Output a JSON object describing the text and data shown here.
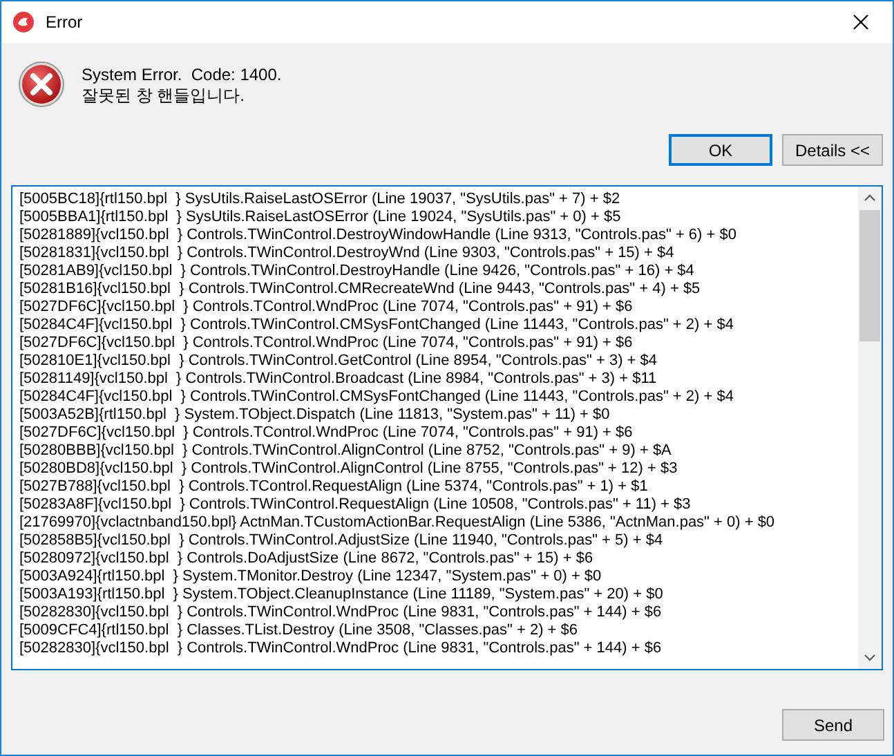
{
  "window": {
    "title": "Error"
  },
  "message": {
    "line_1": "System Error.  Code: 1400.",
    "line_2": "잘못된 창 핸들입니다."
  },
  "buttons": [
    {
      "label": "OK",
      "selected": true
    },
    {
      "label": "Details <<",
      "selected": false
    }
  ],
  "details": {
    "lines": [
      "[5005BC18]{rtl150.bpl  } SysUtils.RaiseLastOSError (Line 19037, \"SysUtils.pas\" + 7) + $2",
      "[5005BBA1]{rtl150.bpl  } SysUtils.RaiseLastOSError (Line 19024, \"SysUtils.pas\" + 0) + $5",
      "[50281889]{vcl150.bpl  } Controls.TWinControl.DestroyWindowHandle (Line 9313, \"Controls.pas\" + 6) + $0",
      "[50281831]{vcl150.bpl  } Controls.TWinControl.DestroyWnd (Line 9303, \"Controls.pas\" + 15) + $4",
      "[50281AB9]{vcl150.bpl  } Controls.TWinControl.DestroyHandle (Line 9426, \"Controls.pas\" + 16) + $4",
      "[50281B16]{vcl150.bpl  } Controls.TWinControl.CMRecreateWnd (Line 9443, \"Controls.pas\" + 4) + $5",
      "[5027DF6C]{vcl150.bpl  } Controls.TControl.WndProc (Line 7074, \"Controls.pas\" + 91) + $6",
      "[50284C4F]{vcl150.bpl  } Controls.TWinControl.CMSysFontChanged (Line 11443, \"Controls.pas\" + 2) + $4",
      "[5027DF6C]{vcl150.bpl  } Controls.TControl.WndProc (Line 7074, \"Controls.pas\" + 91) + $6",
      "[502810E1]{vcl150.bpl  } Controls.TWinControl.GetControl (Line 8954, \"Controls.pas\" + 3) + $4",
      "[50281149]{vcl150.bpl  } Controls.TWinControl.Broadcast (Line 8984, \"Controls.pas\" + 3) + $11",
      "[50284C4F]{vcl150.bpl  } Controls.TWinControl.CMSysFontChanged (Line 11443, \"Controls.pas\" + 2) + $4",
      "[5003A52B]{rtl150.bpl  } System.TObject.Dispatch (Line 11813, \"System.pas\" + 11) + $0",
      "[5027DF6C]{vcl150.bpl  } Controls.TControl.WndProc (Line 7074, \"Controls.pas\" + 91) + $6",
      "[50280BBB]{vcl150.bpl  } Controls.TWinControl.AlignControl (Line 8752, \"Controls.pas\" + 9) + $A",
      "[50280BD8]{vcl150.bpl  } Controls.TWinControl.AlignControl (Line 8755, \"Controls.pas\" + 12) + $3",
      "[5027B788]{vcl150.bpl  } Controls.TControl.RequestAlign (Line 5374, \"Controls.pas\" + 1) + $1",
      "[50283A8F]{vcl150.bpl  } Controls.TWinControl.RequestAlign (Line 10508, \"Controls.pas\" + 11) + $3",
      "[21769970]{vclactnband150.bpl} ActnMan.TCustomActionBar.RequestAlign (Line 5386, \"ActnMan.pas\" + 0) + $0",
      "[502858B5]{vcl150.bpl  } Controls.TWinControl.AdjustSize (Line 11940, \"Controls.pas\" + 5) + $4",
      "[50280972]{vcl150.bpl  } Controls.DoAdjustSize (Line 8672, \"Controls.pas\" + 15) + $6",
      "[5003A924]{rtl150.bpl  } System.TMonitor.Destroy (Line 12347, \"System.pas\" + 0) + $0",
      "[5003A193]{rtl150.bpl  } System.TObject.CleanupInstance (Line 11189, \"System.pas\" + 20) + $0",
      "[50282830]{vcl150.bpl  } Controls.TWinControl.WndProc (Line 9831, \"Controls.pas\" + 144) + $6",
      "[5009CFC4]{rtl150.bpl  } Classes.TList.Destroy (Line 3508, \"Classes.pas\" + 2) + $6",
      "[50282830]{vcl150.bpl  } Controls.TWinControl.WndProc (Line 9831, \"Controls.pas\" + 144) + $6"
    ]
  },
  "send_button": {
    "label": "Send"
  }
}
